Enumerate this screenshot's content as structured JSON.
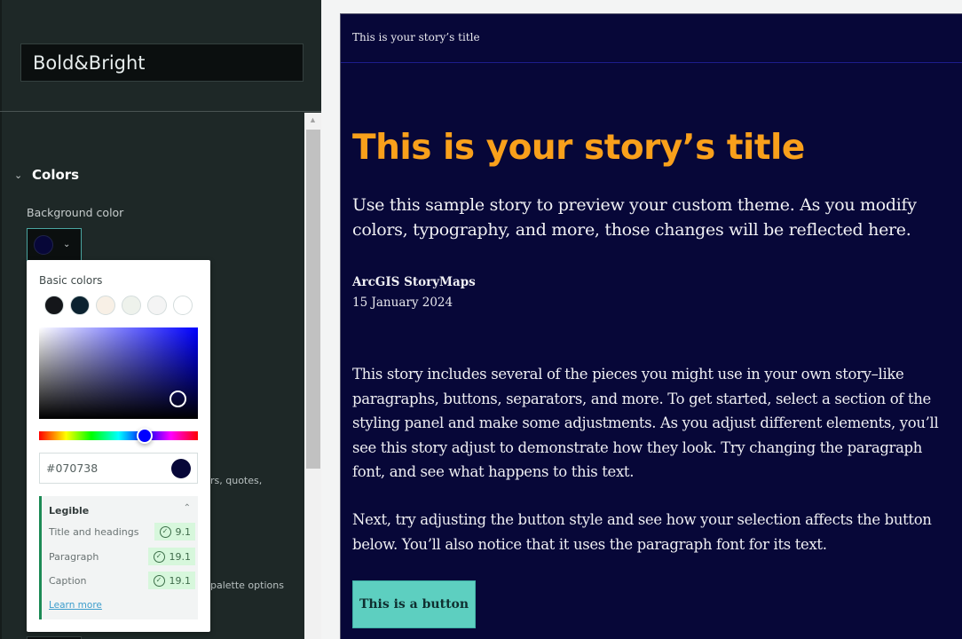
{
  "sidebar": {
    "theme_name": "Bold&Bright",
    "section": {
      "label": "Colors",
      "expanded_icon": "chevron-down-icon"
    },
    "background_color": {
      "label": "Background color",
      "value": "#070738"
    },
    "partial_texts": {
      "quotes_fragment": "rs, quotes,",
      "palette_fragment": "palette options"
    }
  },
  "color_picker": {
    "basic_colors_label": "Basic colors",
    "basic_colors": [
      "#14161a",
      "#0b2230",
      "#f8f0e6",
      "#eef2ec",
      "#f4f4f4",
      "#ffffff"
    ],
    "hue": "#0000ff",
    "hex_value": "#070738",
    "legibility": {
      "title": "Legible",
      "rows": [
        {
          "label": "Title and headings",
          "score": "9.1"
        },
        {
          "label": "Paragraph",
          "score": "19.1"
        },
        {
          "label": "Caption",
          "score": "19.1"
        }
      ],
      "learn_more": "Learn more"
    }
  },
  "preview": {
    "header_title": "This is your story’s title",
    "title": "This is your story’s title",
    "subtitle": "Use this sample story to preview your custom theme. As you modify colors, typography, and more, those changes will be reflected here.",
    "author": "ArcGIS StoryMaps",
    "date": "15 January 2024",
    "paragraphs": [
      "This story includes several of the pieces you might use in your own story–like paragraphs, buttons, separators, and more. To get started, select a section of the styling panel and make some adjustments. As you adjust different elements, you’ll see this story adjust to demonstrate how they look. Try changing the paragraph font, and see what happens to this text.",
      "Next, try adjusting the button style and see how your selection affects the button below. You’ll also notice that it uses the paragraph font for its text."
    ],
    "button_label": "This is a button",
    "colors": {
      "background": "#070738",
      "title": "#f9a01b",
      "button": "#5dcfc0"
    }
  }
}
